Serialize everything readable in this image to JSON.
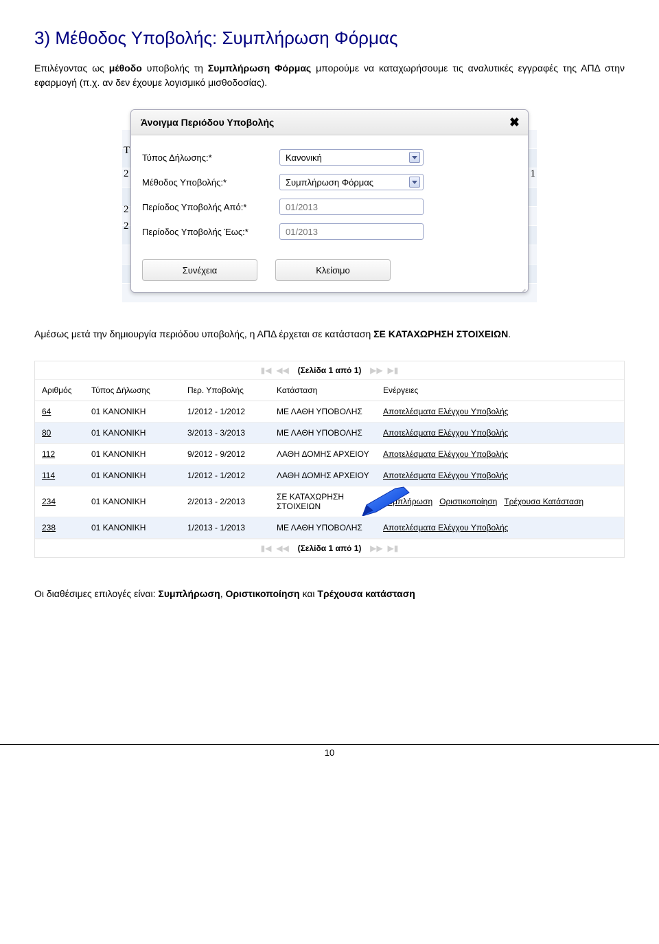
{
  "heading": "3) Μέθοδος Υποβολής: Συμπλήρωση Φόρμας",
  "intro_parts": {
    "p1a": "Επιλέγοντας ως ",
    "p1b": "μέθοδο",
    "p1c": " υποβολής τη ",
    "p1d": "Συμπλήρωση Φόρμας",
    "p1e": " μπορούμε να καταχωρήσουμε τις αναλυτικές εγγραφές της ΑΠΔ στην εφαρμογή (π.χ. αν δεν έχουμε λογισμικό μισθοδοσίας)."
  },
  "dialog": {
    "title": "Άνοιγμα Περιόδου Υποβολής",
    "close": "✖",
    "rows": {
      "type_label": "Τύπος Δήλωσης:*",
      "type_value": "Κανονική",
      "method_label": "Μέθοδος Υποβολής:*",
      "method_value": "Συμπλήρωση Φόρμας",
      "from_label": "Περίοδος Υποβολής Από:*",
      "from_value": "01/2013",
      "to_label": "Περίοδος Υποβολής Έως:*",
      "to_value": "01/2013"
    },
    "buttons": {
      "continue": "Συνέχεια",
      "close": "Κλείσιμο"
    },
    "bg_markers": {
      "top": "Τ",
      "two": "2",
      "mid1": "2",
      "mid2": "2",
      "right": "1"
    }
  },
  "mid_text": {
    "a": "Αμέσως μετά την δημιουργία περιόδου υποβολής, η ΑΠΔ έρχεται σε κατάσταση ",
    "b": "ΣΕ ΚΑΤΑΧΩΡΗΣΗ ΣΤΟΙΧΕΙΩΝ",
    "c": "."
  },
  "grid": {
    "pager": "(Σελίδα 1 από 1)",
    "headers": {
      "id": "Αριθμός",
      "type": "Τύπος Δήλωσης",
      "period": "Περ. Υποβολής",
      "status": "Κατάσταση",
      "actions": "Ενέργειες"
    },
    "rows": [
      {
        "id": "64",
        "type": "01 ΚΑΝΟΝΙΚΗ",
        "period": "1/2012 - 1/2012",
        "status": "ΜΕ ΛΑΘΗ ΥΠΟΒΟΛΗΣ",
        "actions": [
          {
            "label": "Αποτελέσματα Ελέγχου Υποβολής"
          }
        ]
      },
      {
        "id": "80",
        "type": "01 ΚΑΝΟΝΙΚΗ",
        "period": "3/2013 - 3/2013",
        "status": "ΜΕ ΛΑΘΗ ΥΠΟΒΟΛΗΣ",
        "actions": [
          {
            "label": "Αποτελέσματα Ελέγχου Υποβολής"
          }
        ]
      },
      {
        "id": "112",
        "type": "01 ΚΑΝΟΝΙΚΗ",
        "period": "9/2012 - 9/2012",
        "status": "ΛΑΘΗ ΔΟΜΗΣ ΑΡΧΕΙΟΥ",
        "actions": [
          {
            "label": "Αποτελέσματα Ελέγχου Υποβολής"
          }
        ]
      },
      {
        "id": "114",
        "type": "01 ΚΑΝΟΝΙΚΗ",
        "period": "1/2012 - 1/2012",
        "status": "ΛΑΘΗ ΔΟΜΗΣ ΑΡΧΕΙΟΥ",
        "actions": [
          {
            "label": "Αποτελέσματα Ελέγχου Υποβολής"
          }
        ]
      },
      {
        "id": "234",
        "type": "01 ΚΑΝΟΝΙΚΗ",
        "period": "2/2013 - 2/2013",
        "status": "ΣΕ ΚΑΤΑΧΩΡΗΣΗ ΣΤΟΙΧΕΙΩΝ",
        "actions": [
          {
            "label": "Συμπλήρωση"
          },
          {
            "label": "Οριστικοποίηση"
          },
          {
            "label": "Τρέχουσα Κατάσταση"
          }
        ]
      },
      {
        "id": "238",
        "type": "01 ΚΑΝΟΝΙΚΗ",
        "period": "1/2013 - 1/2013",
        "status": "ΜΕ ΛΑΘΗ ΥΠΟΒΟΛΗΣ",
        "actions": [
          {
            "label": "Αποτελέσματα Ελέγχου Υποβολής"
          }
        ]
      }
    ]
  },
  "footer_text": {
    "a": "Οι διαθέσιμες επιλογές είναι: ",
    "b1": "Συμπλήρωση",
    "sep1": ", ",
    "b2": "Οριστικοποίηση",
    "sep2": " και ",
    "b3": "Τρέχουσα κατάσταση"
  },
  "page_number": "10"
}
